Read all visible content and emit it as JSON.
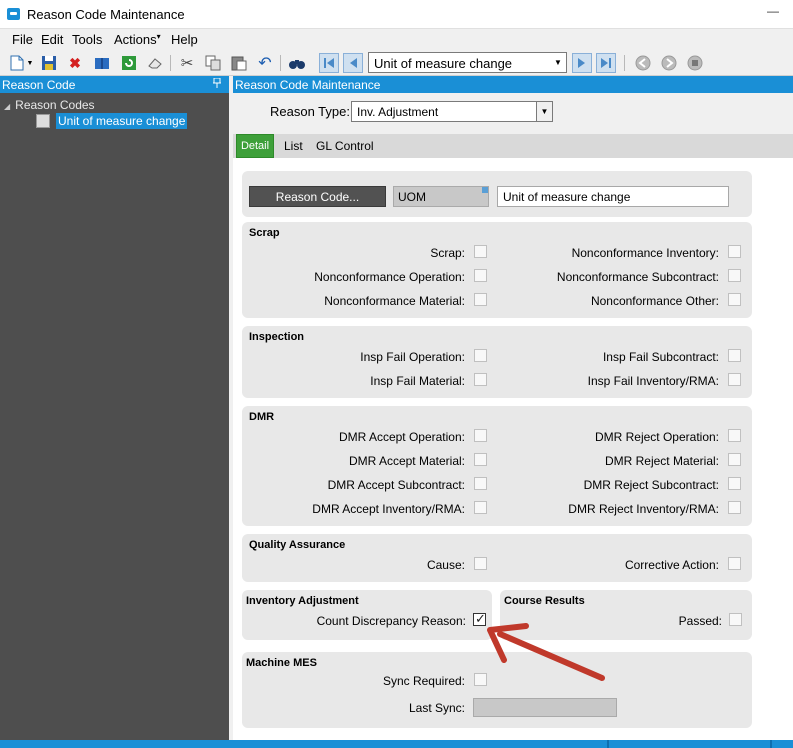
{
  "window": {
    "title": "Reason Code Maintenance",
    "minimize_glyph": "—"
  },
  "menu": [
    "File",
    "Edit",
    "Tools",
    "Actions",
    "Help"
  ],
  "toolbar": {
    "icons": [
      "new-icon",
      "save-icon",
      "delete-icon",
      "open-book-icon",
      "refresh-icon",
      "eraser-icon",
      "cut-icon",
      "copy-icon",
      "paste-icon",
      "undo-icon",
      "binoculars-icon",
      "first-record-icon",
      "prev-record-icon",
      "next-record-icon",
      "last-record-icon",
      "back-icon",
      "forward-icon",
      "stop-icon"
    ],
    "nav_value": "Unit of measure change",
    "dropdown_glyph": "▼"
  },
  "tree": {
    "header": "Reason Code",
    "pin_glyph": "📌",
    "root_label": "Reason Codes",
    "expand_glyph": "◢",
    "selected_item": "Unit of measure change"
  },
  "main": {
    "header": "Reason Code Maintenance",
    "reason_type_label": "Reason Type:",
    "reason_type_value": "Inv.  Adjustment",
    "tabs": {
      "detail": "Detail",
      "list": "List",
      "gl_control": "GL Control"
    },
    "reason_code_button": "Reason Code...",
    "reason_code_id": "UOM",
    "reason_code_desc": "Unit of measure change"
  },
  "scrap": {
    "title": "Scrap",
    "scrap": "Scrap:",
    "nc_inventory": "Nonconformance Inventory:",
    "nc_operation": "Nonconformance Operation:",
    "nc_subcontract": "Nonconformance Subcontract:",
    "nc_material": "Nonconformance Material:",
    "nc_other": "Nonconformance Other:"
  },
  "inspection": {
    "title": "Inspection",
    "fail_operation": "Insp Fail Operation:",
    "fail_subcontract": "Insp Fail Subcontract:",
    "fail_material": "Insp Fail Material:",
    "fail_inventory": "Insp Fail Inventory/RMA:"
  },
  "dmr": {
    "title": "DMR",
    "accept_operation": "DMR Accept Operation:",
    "reject_operation": "DMR Reject Operation:",
    "accept_material": "DMR Accept Material:",
    "reject_material": "DMR Reject Material:",
    "accept_subcontract": "DMR Accept Subcontract:",
    "reject_subcontract": "DMR Reject Subcontract:",
    "accept_inventory": "DMR Accept Inventory/RMA:",
    "reject_inventory": "DMR Reject Inventory/RMA:"
  },
  "quality": {
    "title": "Quality Assurance",
    "cause": "Cause:",
    "corrective_action": "Corrective Action:"
  },
  "inventory_adjustment": {
    "title": "Inventory Adjustment",
    "count_discrepancy": "Count Discrepancy Reason:",
    "count_discrepancy_checked": true
  },
  "course_results": {
    "title": "Course Results",
    "passed": "Passed:"
  },
  "machine_mes": {
    "title": "Machine MES",
    "sync_required": "Sync Required:",
    "last_sync": "Last Sync:",
    "last_sync_value": ""
  },
  "colors": {
    "accent": "#1a8fd6",
    "tab_active": "#3ea03a",
    "annotation_arrow": "#c0392b"
  }
}
